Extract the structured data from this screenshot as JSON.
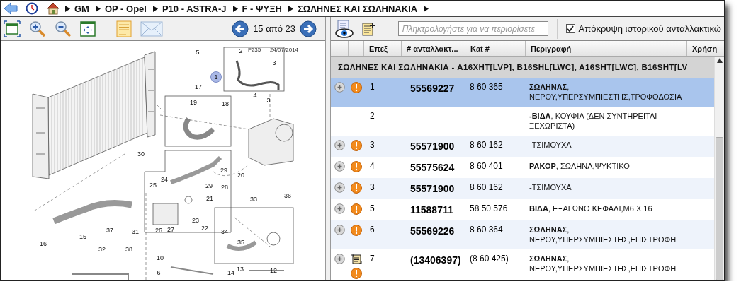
{
  "breadcrumb": [
    "GM",
    "OP - Opel",
    "P10 - ASTRA-J",
    "F - ΨΥΞΗ",
    "ΣΩΛΗΝΕΣ ΚΑΙ ΣΩΛΗΝΑΚΙΑ"
  ],
  "pager": {
    "text": "15 από 23"
  },
  "diagram": {
    "code": "F235",
    "date": "24/07/2014",
    "callouts": [
      {
        "label": "5",
        "selected": false
      },
      {
        "label": "2",
        "selected": false
      },
      {
        "label": "3",
        "selected": false
      },
      {
        "label": "1",
        "selected": true
      },
      {
        "label": "17",
        "selected": false
      },
      {
        "label": "4",
        "selected": false
      },
      {
        "label": "3",
        "selected": false
      },
      {
        "label": "19",
        "selected": false
      },
      {
        "label": "18",
        "selected": false
      },
      {
        "label": "30",
        "selected": false
      },
      {
        "label": "29",
        "selected": false
      },
      {
        "label": "20",
        "selected": false
      },
      {
        "label": "24",
        "selected": false
      },
      {
        "label": "25",
        "selected": false
      },
      {
        "label": "29",
        "selected": false
      },
      {
        "label": "28",
        "selected": false
      },
      {
        "label": "21",
        "selected": false
      },
      {
        "label": "33",
        "selected": false
      },
      {
        "label": "36",
        "selected": false
      },
      {
        "label": "23",
        "selected": false
      },
      {
        "label": "22",
        "selected": false
      },
      {
        "label": "37",
        "selected": false
      },
      {
        "label": "26",
        "selected": false
      },
      {
        "label": "27",
        "selected": false
      },
      {
        "label": "15",
        "selected": false
      },
      {
        "label": "16",
        "selected": false
      },
      {
        "label": "34",
        "selected": false
      },
      {
        "label": "35",
        "selected": false
      },
      {
        "label": "31",
        "selected": false
      },
      {
        "label": "32",
        "selected": false
      },
      {
        "label": "38",
        "selected": false
      },
      {
        "label": "10",
        "selected": false
      },
      {
        "label": "13",
        "selected": false
      },
      {
        "label": "14",
        "selected": false
      },
      {
        "label": "12",
        "selected": false
      },
      {
        "label": "6",
        "selected": false
      }
    ]
  },
  "filter": {
    "placeholder": "Πληκτρολογήστε για να περιορίσετε"
  },
  "hide_history": {
    "label": "Απόκρυψη ιστορικού ανταλλακτικώ",
    "checked": true
  },
  "table": {
    "columns": [
      "Επεξ",
      "# ανταλλακτ...",
      "Kat #",
      "Περιγραφή",
      "Χρήση"
    ],
    "group": "ΣΩΛΗΝΕΣ ΚΑΙ ΣΩΛΗΝΑΚΙΑ - A16XHT[LVP], B16SHL[LWC], A16SHT[LWC], B16SHT[LV",
    "rows": [
      {
        "item": "1",
        "part": "55569227",
        "cat": "8 60 365",
        "description": "**ΣΩΛΗΝΑΣ**,\nΝΕΡΟΥ,ΥΠΕΡΣΥΜΠΙΕΣΤΗΣ,ΤΡΟΦΟΔΟΣΙΑ",
        "selected": true,
        "expandable": true,
        "warning": true,
        "note": false
      },
      {
        "item": "2",
        "description": "**-ΒΙΔΑ**, ΚΟΥΦΙΑ  (ΔΕΝ ΣΥΝΤΗΡΕΙΤΑΙ\nΞΕΧΩΡΙΣΤΑ)",
        "selected": false,
        "expandable": false,
        "warning": false,
        "note": false
      },
      {
        "item": "3",
        "part": "55571900",
        "cat": "8 60 162",
        "description": "-ΤΣΙΜΟΥΧΑ",
        "selected": false,
        "expandable": true,
        "warning": true,
        "note": false
      },
      {
        "item": "4",
        "part": "55575624",
        "cat": "8 60 401",
        "description": "**ΡΑΚΟΡ**, ΣΩΛΗΝΑ,ΨΥΚΤΙΚΟ",
        "selected": false,
        "expandable": true,
        "warning": true,
        "note": false
      },
      {
        "item": "3",
        "part": "55571900",
        "cat": "8 60 162",
        "description": "-ΤΣΙΜΟΥΧΑ",
        "selected": false,
        "expandable": true,
        "warning": true,
        "note": false
      },
      {
        "item": "5",
        "part": "11588711",
        "cat": "58 50 576",
        "description": "**ΒΙΔΑ**, ΕΞΑΓΩΝΟ ΚΕΦΑΛΙ,M6 X 16",
        "selected": false,
        "expandable": true,
        "warning": true,
        "note": false
      },
      {
        "item": "6",
        "part": "55569226",
        "cat": "8 60 364",
        "description": "**ΣΩΛΗΝΑΣ**,\nΝΕΡΟΥ,ΥΠΕΡΣΥΜΠΙΕΣΤΗΣ,ΕΠΙΣΤΡΟΦΗ",
        "selected": false,
        "expandable": true,
        "warning": true,
        "note": false
      },
      {
        "item": "7",
        "part": "(13406397)",
        "cat": "(8 60 425)",
        "description": "**ΣΩΛΗΝΑΣ**,\nΝΕΡΟΥ,ΥΠΕΡΣΥΜΠΙΕΣΤΗΣ,ΕΠΙΣΤΡΟΦΗ",
        "selected": false,
        "expandable": true,
        "warning": true,
        "note": true
      }
    ]
  }
}
